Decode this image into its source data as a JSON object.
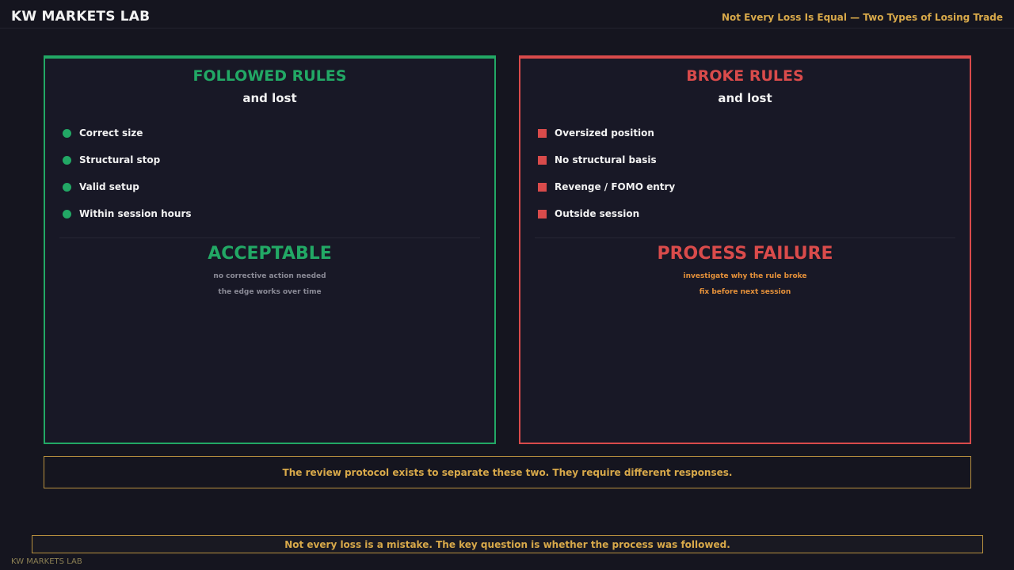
{
  "header": {
    "brand": "KW MARKETS LAB",
    "subtitle": "Not Every Loss Is Equal — Two Types of Losing Trade"
  },
  "panels": {
    "followed": {
      "title": "FOLLOWED RULES",
      "subtitle": "and lost",
      "items": [
        "Correct size",
        "Structural stop",
        "Valid setup",
        "Within session hours"
      ],
      "verdict": "ACCEPTABLE",
      "notes": [
        "no corrective action needed",
        "the edge works over time"
      ],
      "accent_color": "#22a865",
      "bullet_icon": "circle-bullet-icon"
    },
    "broke": {
      "title": "BROKE RULES",
      "subtitle": "and lost",
      "items": [
        "Oversized position",
        "No structural basis",
        "Revenge / FOMO entry",
        "Outside session"
      ],
      "verdict": "PROCESS FAILURE",
      "notes": [
        "investigate why the rule broke",
        "fix before next session"
      ],
      "accent_color": "#d94b4b",
      "bullet_icon": "square-bullet-icon"
    }
  },
  "callout": "The review protocol exists to separate these two. They require different responses.",
  "footer": {
    "message": "Not every loss is a mistake. The key question is whether the process was followed.",
    "brand": "KW MARKETS LAB"
  },
  "colors": {
    "background": "#15151f",
    "gold": "#d8a94a",
    "orange": "#e5913a"
  }
}
